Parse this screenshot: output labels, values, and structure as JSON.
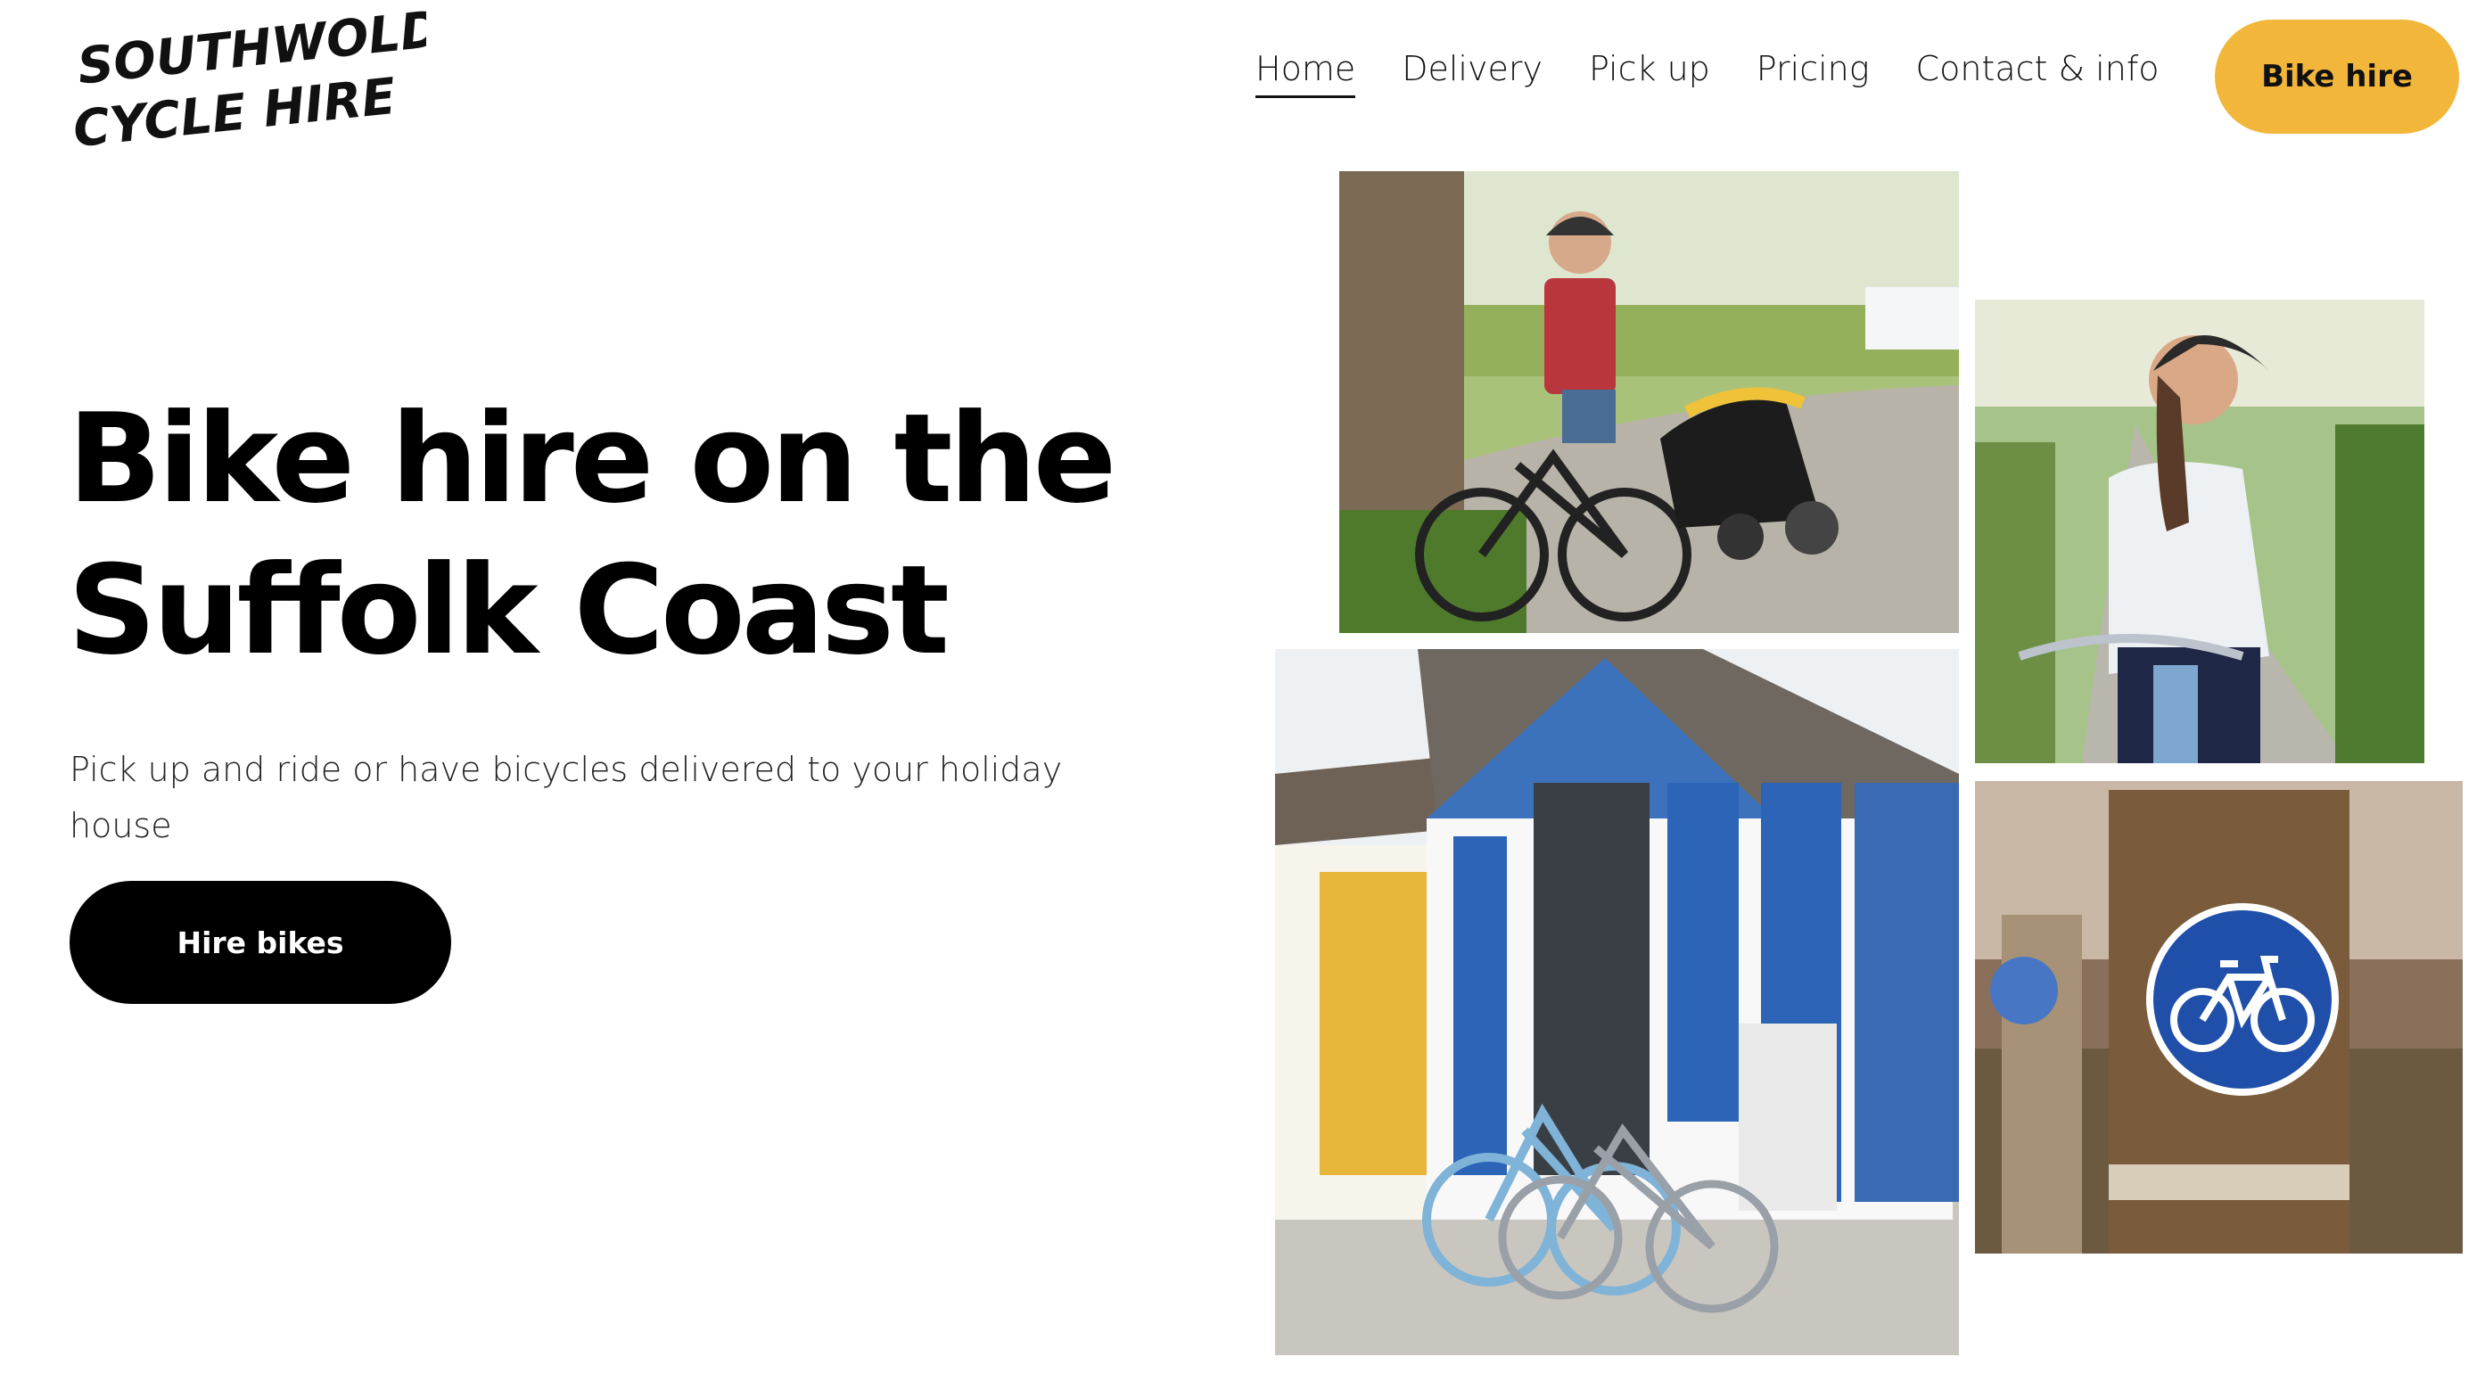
{
  "brand": {
    "logo_line1": "SOUTHWOLD",
    "logo_line2": "CYCLE HIRE"
  },
  "nav": {
    "items": [
      {
        "label": "Home",
        "active": true
      },
      {
        "label": "Delivery",
        "active": false
      },
      {
        "label": "Pick up",
        "active": false
      },
      {
        "label": "Pricing",
        "active": false
      },
      {
        "label": "Contact & info",
        "active": false
      }
    ],
    "cta_label": "Bike hire"
  },
  "hero": {
    "title_line1": "Bike hire on the",
    "title_line2": "Suffolk Coast",
    "subtitle": "Pick up and ride or have bicycles delivered to your holiday house",
    "cta_label": "Hire bikes"
  },
  "colors": {
    "accent": "#f2b63a",
    "text": "#000000",
    "background": "#ffffff",
    "sign_blue": "#1f4fa8"
  },
  "photos": [
    {
      "name": "photo-cyclist-with-child-trailer",
      "icon": "bicycle-trailer"
    },
    {
      "name": "photo-woman-cycling",
      "icon": "cyclist"
    },
    {
      "name": "photo-beach-huts-bicycles",
      "icon": "beach-huts"
    },
    {
      "name": "photo-cycle-route-sign",
      "icon": "bicycle-sign"
    }
  ]
}
